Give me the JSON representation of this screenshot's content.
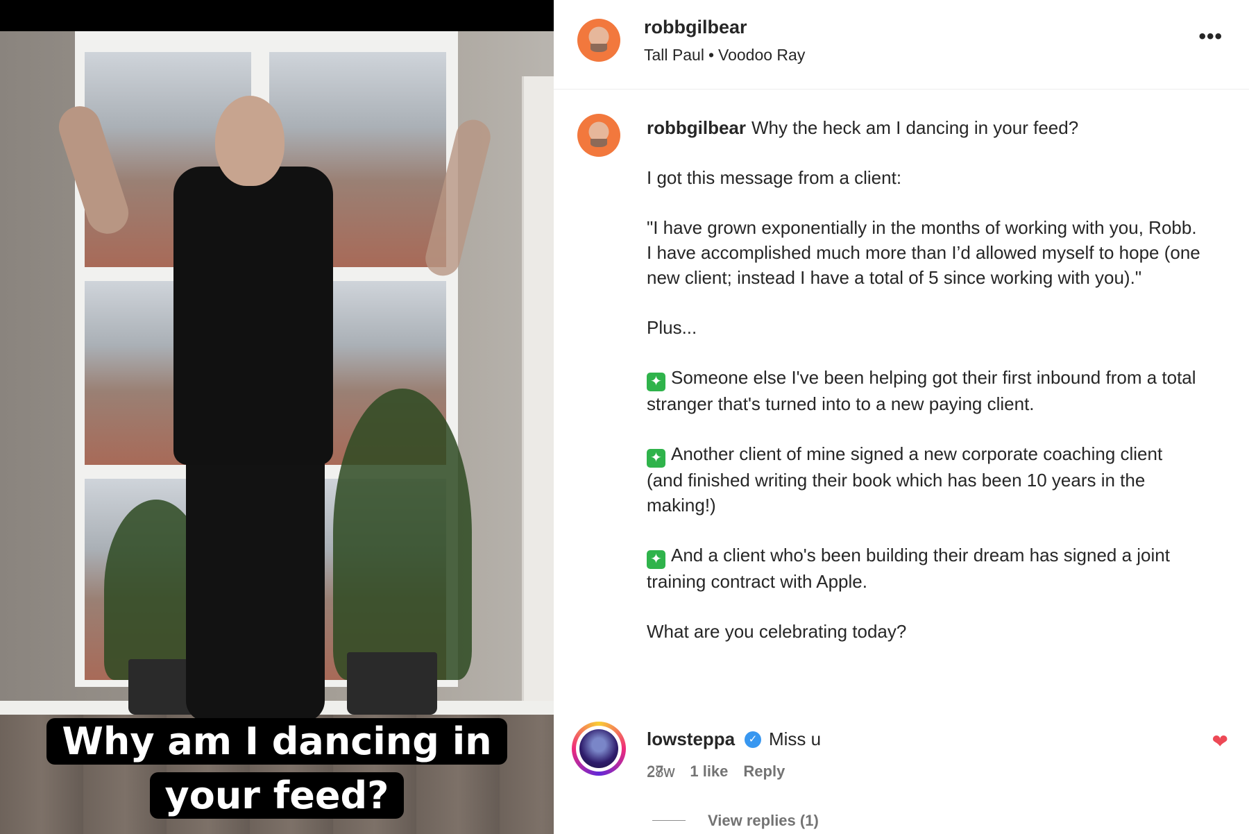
{
  "video": {
    "caption_line1": "Why am I dancing in",
    "caption_line2": "your feed?"
  },
  "header": {
    "username": "robbgilbear",
    "audio_artist": "Tall Paul",
    "audio_separator": "•",
    "audio_track": "Voodoo Ray",
    "more_icon": "more-horizontal-icon",
    "more_label": "•••"
  },
  "post": {
    "username": "robbgilbear",
    "paragraphs": [
      "Why the heck am I dancing in your feed?",
      "I got this message from a client:",
      "\"I have grown exponentially in the months of working with you, Robb. I have accomplished much more than I’d allowed myself to hope (one new client; instead I have a total of 5 since working with you).\"",
      "Plus...",
      "Someone else I've been helping got their first inbound from a total stranger that's turned into to a new paying client.",
      "Another client of mine signed a new corporate coaching client (and finished writing their book which has been 10 years in the making!)",
      "And a client who's been building their dream has signed a joint training contract with Apple.",
      "What are you celebrating today?"
    ],
    "sparkle_icon": "sparkles-icon",
    "sparkle_glyph": "✦",
    "time_ago": "28w"
  },
  "comment": {
    "username": "lowsteppa",
    "verified_glyph": "✓",
    "text": "Miss u",
    "time_ago": "27w",
    "likes": "1 like",
    "reply_label": "Reply",
    "heart_glyph": "❤",
    "view_replies_label": "View replies (1)"
  },
  "colors": {
    "text_primary": "#262626",
    "text_secondary": "#737373",
    "verified_blue": "#3897f0",
    "like_red": "#ed4956",
    "sparkle_green": "#2fb34b"
  }
}
